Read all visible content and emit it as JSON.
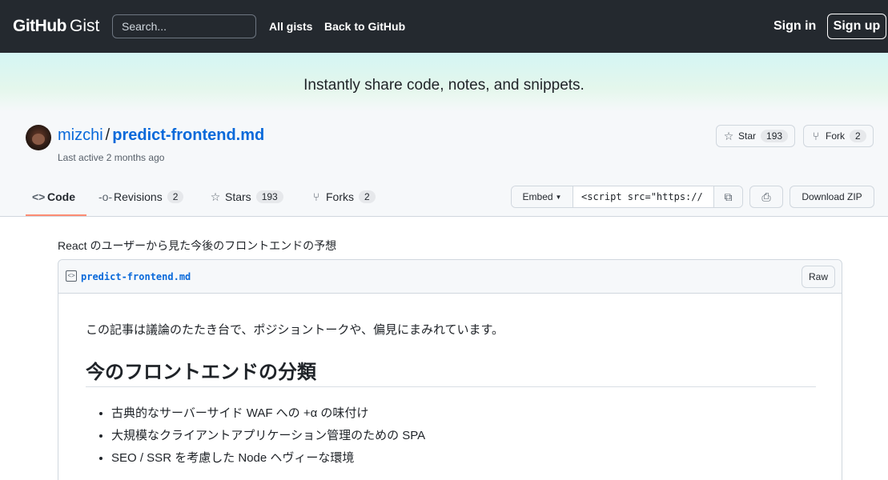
{
  "header": {
    "logo_primary": "GitHub",
    "logo_secondary": "Gist",
    "search_placeholder": "Search...",
    "nav": [
      "All gists",
      "Back to GitHub"
    ],
    "sign_in": "Sign in",
    "sign_up": "Sign up"
  },
  "banner": {
    "text": "Instantly share code, notes, and snippets."
  },
  "gist": {
    "owner": "mizchi",
    "separator": "/",
    "name": "predict-frontend.md",
    "last_active": "Last active 2 months ago",
    "star_label": "Star",
    "star_count": "193",
    "fork_label": "Fork",
    "fork_count": "2"
  },
  "tabs": [
    {
      "label": "Code",
      "icon": "code-icon"
    },
    {
      "label": "Revisions",
      "count": "2",
      "icon": "commit-icon"
    },
    {
      "label": "Stars",
      "count": "193",
      "icon": "star-icon"
    },
    {
      "label": "Forks",
      "count": "2",
      "icon": "fork-icon"
    }
  ],
  "embed": {
    "select_label": "Embed",
    "value": "<script src=\"https://"
  },
  "download_zip": "Download ZIP",
  "description": "React のユーザーから見た今後のフロントエンドの予想",
  "file": {
    "filename": "predict-frontend.md",
    "raw_label": "Raw",
    "intro": "この記事は議論のたたき台で、ポジショントークや、偏見にまみれています。",
    "heading": "今のフロントエンドの分類",
    "list": [
      "古典的なサーバーサイド WAF への +α の味付け",
      "大規模なクライアントアプリケーション管理のための SPA",
      "SEO / SSR を考慮した Node ヘヴィーな環境"
    ]
  }
}
